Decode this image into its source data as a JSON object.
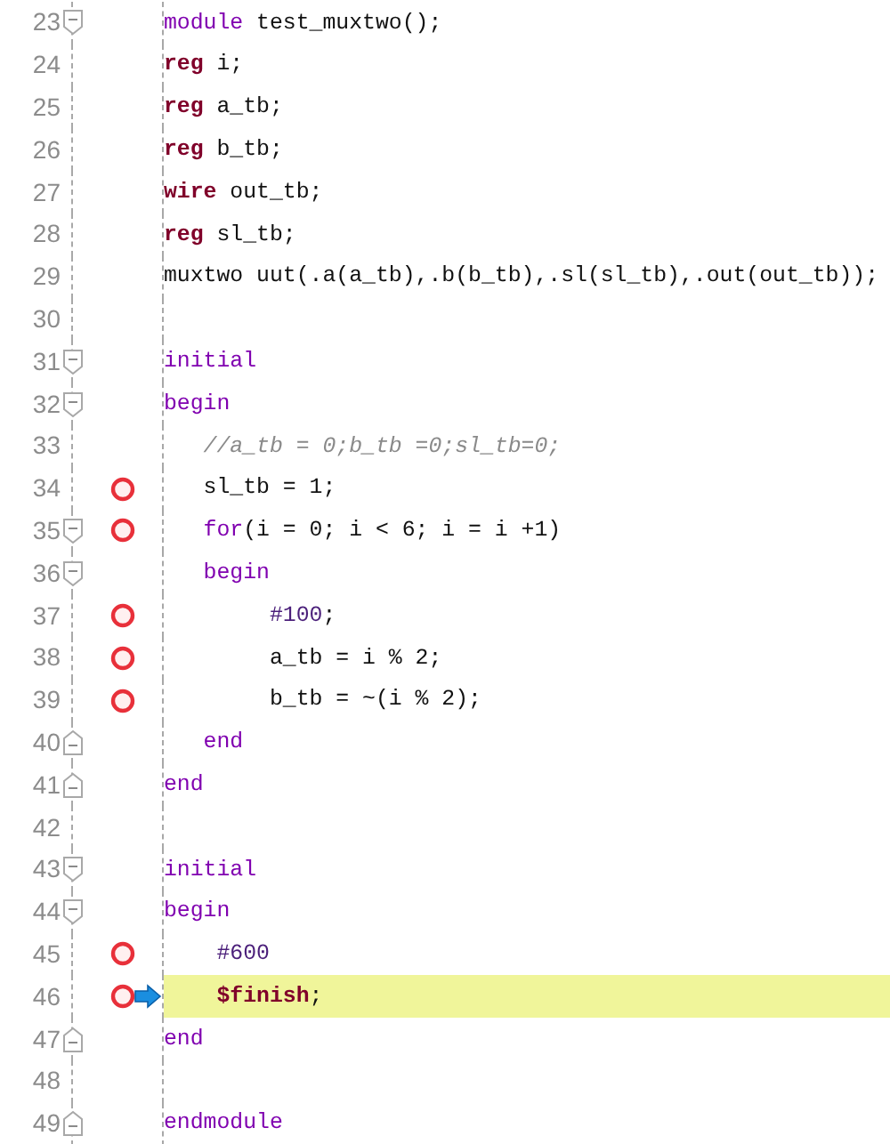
{
  "lines": [
    {
      "number": "23",
      "kind": "fold-start",
      "breakpoint": false,
      "current": false,
      "tokens": [
        {
          "kind": "keyword",
          "text": "module"
        },
        {
          "kind": "plain",
          "text": " test_muxtwo();"
        }
      ]
    },
    {
      "number": "24",
      "kind": "plain",
      "breakpoint": false,
      "current": false,
      "tokens": [
        {
          "kind": "type",
          "text": "reg"
        },
        {
          "kind": "plain",
          "text": " i;"
        }
      ]
    },
    {
      "number": "25",
      "kind": "plain",
      "breakpoint": false,
      "current": false,
      "tokens": [
        {
          "kind": "type",
          "text": "reg"
        },
        {
          "kind": "plain",
          "text": " a_tb;"
        }
      ]
    },
    {
      "number": "26",
      "kind": "plain",
      "breakpoint": false,
      "current": false,
      "tokens": [
        {
          "kind": "type",
          "text": "reg"
        },
        {
          "kind": "plain",
          "text": " b_tb;"
        }
      ]
    },
    {
      "number": "27",
      "kind": "plain",
      "breakpoint": false,
      "current": false,
      "tokens": [
        {
          "kind": "type",
          "text": "wire"
        },
        {
          "kind": "plain",
          "text": " out_tb;"
        }
      ]
    },
    {
      "number": "28",
      "kind": "plain",
      "breakpoint": false,
      "current": false,
      "tokens": [
        {
          "kind": "type",
          "text": "reg"
        },
        {
          "kind": "plain",
          "text": " sl_tb;"
        }
      ]
    },
    {
      "number": "29",
      "kind": "plain",
      "breakpoint": false,
      "current": false,
      "tokens": [
        {
          "kind": "plain",
          "text": "muxtwo uut(.a(a_tb),.b(b_tb),.sl(sl_tb),.out(out_tb));"
        }
      ]
    },
    {
      "number": "30",
      "kind": "plain",
      "breakpoint": false,
      "current": false
    },
    {
      "number": "31",
      "kind": "fold-start",
      "breakpoint": false,
      "current": false,
      "tokens": [
        {
          "kind": "keyword",
          "text": "initial"
        }
      ]
    },
    {
      "number": "32",
      "kind": "fold-start",
      "breakpoint": false,
      "current": false,
      "tokens": [
        {
          "kind": "keyword",
          "text": "begin"
        }
      ]
    },
    {
      "number": "33",
      "kind": "plain",
      "breakpoint": false,
      "current": false,
      "tokens": [
        {
          "kind": "comment",
          "text": "   //a_tb = 0;b_tb =0;sl_tb=0;"
        }
      ]
    },
    {
      "number": "34",
      "kind": "plain",
      "breakpoint": true,
      "current": false,
      "tokens": [
        {
          "kind": "plain",
          "text": "   sl_tb = 1;"
        }
      ]
    },
    {
      "number": "35",
      "kind": "fold-start",
      "breakpoint": true,
      "current": false,
      "tokens": [
        {
          "kind": "keyword",
          "text": "   for"
        },
        {
          "kind": "plain",
          "text": "(i = 0; i < 6; i = i +1)"
        }
      ]
    },
    {
      "number": "36",
      "kind": "fold-start",
      "breakpoint": false,
      "current": false,
      "tokens": [
        {
          "kind": "keyword",
          "text": "   begin"
        }
      ]
    },
    {
      "number": "37",
      "kind": "plain",
      "breakpoint": true,
      "current": false,
      "tokens": [
        {
          "kind": "delay",
          "text": "        #100"
        },
        {
          "kind": "plain",
          "text": ";"
        }
      ]
    },
    {
      "number": "38",
      "kind": "plain",
      "breakpoint": true,
      "current": false,
      "tokens": [
        {
          "kind": "plain",
          "text": "        a_tb = i % 2;"
        }
      ]
    },
    {
      "number": "39",
      "kind": "plain",
      "breakpoint": true,
      "current": false,
      "tokens": [
        {
          "kind": "plain",
          "text": "        b_tb = ~(i % 2);"
        }
      ]
    },
    {
      "number": "40",
      "kind": "fold-end",
      "breakpoint": false,
      "current": false,
      "tokens": [
        {
          "kind": "keyword",
          "text": "   end"
        }
      ]
    },
    {
      "number": "41",
      "kind": "fold-end",
      "breakpoint": false,
      "current": false,
      "tokens": [
        {
          "kind": "keyword",
          "text": "end"
        }
      ]
    },
    {
      "number": "42",
      "kind": "plain",
      "breakpoint": false,
      "current": false
    },
    {
      "number": "43",
      "kind": "fold-start",
      "breakpoint": false,
      "current": false,
      "tokens": [
        {
          "kind": "keyword",
          "text": "initial"
        }
      ]
    },
    {
      "number": "44",
      "kind": "fold-start",
      "breakpoint": false,
      "current": false,
      "tokens": [
        {
          "kind": "keyword",
          "text": "begin"
        }
      ]
    },
    {
      "number": "45",
      "kind": "plain",
      "breakpoint": true,
      "current": false,
      "tokens": [
        {
          "kind": "delay",
          "text": "    #600"
        }
      ]
    },
    {
      "number": "46",
      "kind": "plain",
      "breakpoint": true,
      "current": true,
      "tokens": [
        {
          "kind": "type",
          "text": "    $finish"
        },
        {
          "kind": "plain",
          "text": ";"
        }
      ]
    },
    {
      "number": "47",
      "kind": "fold-end",
      "breakpoint": false,
      "current": false,
      "tokens": [
        {
          "kind": "keyword",
          "text": "end"
        }
      ]
    },
    {
      "number": "48",
      "kind": "plain",
      "breakpoint": false,
      "current": false
    },
    {
      "number": "49",
      "kind": "fold-end",
      "breakpoint": false,
      "current": false,
      "tokens": [
        {
          "kind": "keyword",
          "text": "endmodule"
        }
      ]
    }
  ]
}
